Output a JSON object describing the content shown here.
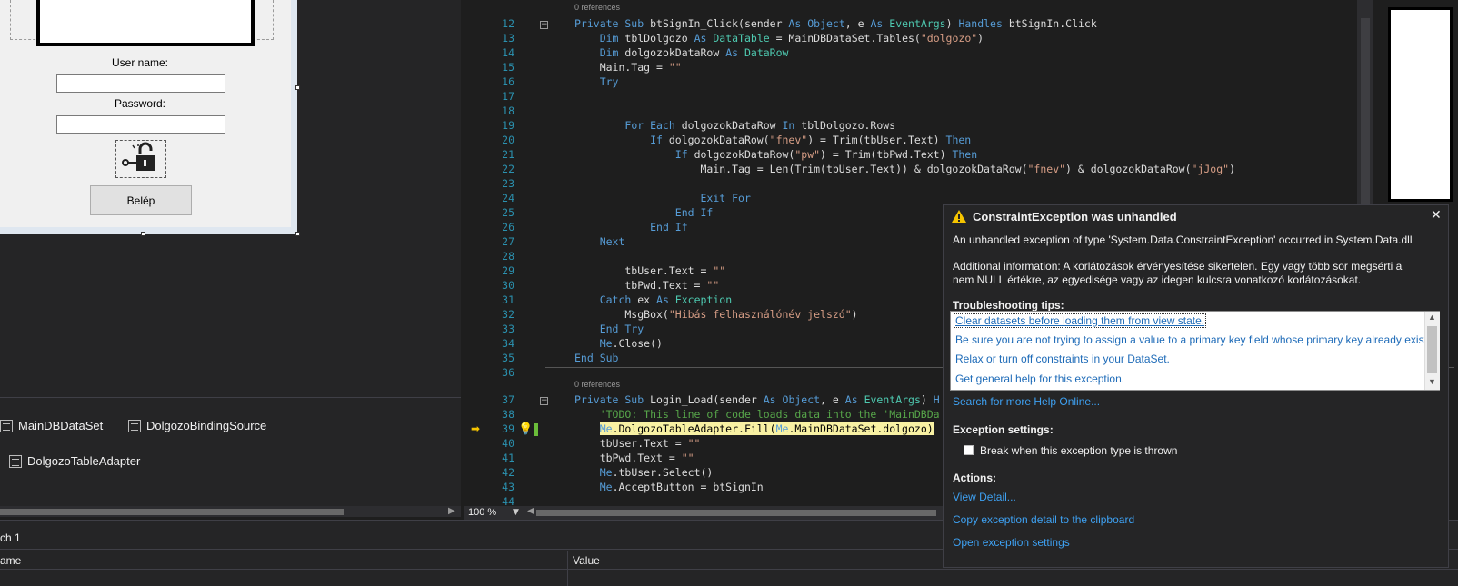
{
  "designer": {
    "labels": {
      "user_name": "User name:",
      "password": "Password:"
    },
    "login_button": "Belép",
    "lock_icon": "lock-open-icon",
    "component_tray": [
      "MainDBDataSet",
      "DolgozoBindingSource",
      "DolgozoTableAdapter"
    ]
  },
  "editor": {
    "references_label": "0 references",
    "zoom": "100 %",
    "lines": [
      {
        "n": "12"
      },
      {
        "n": "13"
      },
      {
        "n": "14"
      },
      {
        "n": "15"
      },
      {
        "n": "16"
      },
      {
        "n": "17"
      },
      {
        "n": "18"
      },
      {
        "n": "19"
      },
      {
        "n": "20"
      },
      {
        "n": "21"
      },
      {
        "n": "22"
      },
      {
        "n": "23"
      },
      {
        "n": "24"
      },
      {
        "n": "25"
      },
      {
        "n": "26"
      },
      {
        "n": "27"
      },
      {
        "n": "28"
      },
      {
        "n": "29"
      },
      {
        "n": "30"
      },
      {
        "n": "31"
      },
      {
        "n": "32"
      },
      {
        "n": "33"
      },
      {
        "n": "34"
      },
      {
        "n": "35"
      },
      {
        "n": "36"
      },
      {
        "n": "37"
      },
      {
        "n": "38"
      },
      {
        "n": "39"
      },
      {
        "n": "40"
      },
      {
        "n": "41"
      },
      {
        "n": "42"
      },
      {
        "n": "43"
      },
      {
        "n": "44"
      }
    ]
  },
  "exception": {
    "title": "ConstraintException was unhandled",
    "message": "An unhandled exception of type 'System.Data.ConstraintException' occurred in System.Data.dll",
    "additional_info": "Additional information: A korlátozások érvényesítése sikertelen. Egy vagy több sor megsérti a nem NULL értékre, az egyedisége vagy az idegen kulcsra vonatkozó korlátozásokat.",
    "tips_heading": "Troubleshooting tips:",
    "tips": [
      "Clear datasets before loading them from view state.",
      "Be sure you are not trying to assign a value to a primary key field whose primary key already exists.",
      "Relax or turn off constraints in your DataSet.",
      "Get general help for this exception."
    ],
    "search_online": "Search for more Help Online...",
    "settings_heading": "Exception settings:",
    "break_label": "Break when this exception type is thrown",
    "actions_heading": "Actions:",
    "actions": [
      "View Detail...",
      "Copy exception detail to the clipboard",
      "Open exception settings"
    ]
  },
  "bottom_panel": {
    "tab_label": "ch 1",
    "columns": [
      "ame",
      "Value"
    ]
  },
  "colors": {
    "accent_link": "#3ea1f2",
    "keyword": "#569cd6",
    "type": "#4ec9b0",
    "string": "#d69d85",
    "comment": "#57a64a"
  }
}
